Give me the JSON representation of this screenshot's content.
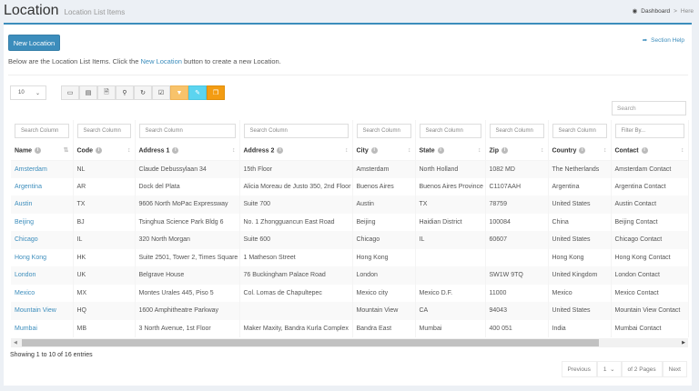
{
  "header": {
    "title": "Location",
    "subtitle": "Location List Items"
  },
  "breadcrumb": {
    "home": "Dashboard",
    "separator": ">",
    "current": "Here"
  },
  "panel": {
    "new_button": "New Location",
    "section_help": "Section Help",
    "intro_before": "Below are the Location List Items. Click the ",
    "intro_link": "New Location",
    "intro_after": " button to create a new Location.",
    "page_length": "10",
    "search_placeholder": "Search"
  },
  "toolbar": [
    "monitor-icon",
    "columns-icon",
    "file-icon",
    "zoom-icon",
    "refresh-icon",
    "check-square-icon",
    "filter-icon",
    "edit-icon",
    "copy-icon"
  ],
  "table": {
    "filters": [
      "Search Column",
      "Search Column",
      "Search Column",
      "Search Column",
      "Search Column",
      "Search Column",
      "Search Column",
      "Search Column",
      "Filter By..."
    ],
    "columns": [
      "Name",
      "Code",
      "Address 1",
      "Address 2",
      "City",
      "State",
      "Zip",
      "Country",
      "Contact"
    ],
    "rows": [
      [
        "Amsterdam",
        "NL",
        "Claude Debussylaan 34",
        "15th Floor",
        "Amsterdam",
        "North Holland",
        "1082 MD",
        "The Netherlands",
        "Amsterdam Contact"
      ],
      [
        "Argentina",
        "AR",
        "Dock del Plata",
        "Alicia Moreau de Justo 350, 2nd Floor",
        "Buenos Aires",
        "Buenos Aires Province",
        "C1107AAH",
        "Argentina",
        "Argentina Contact"
      ],
      [
        "Austin",
        "TX",
        "9606 North MoPac Expressway",
        "Suite 700",
        "Austin",
        "TX",
        "78759",
        "United States",
        "Austin Contact"
      ],
      [
        "Beijing",
        "BJ",
        "Tsinghua Science Park Bldg 6",
        "No. 1 Zhongguancun East Road",
        "Beijing",
        "Haidian District",
        "100084",
        "China",
        "Beijing Contact"
      ],
      [
        "Chicago",
        "IL",
        "320 North Morgan",
        "Suite 600",
        "Chicago",
        "IL",
        "60607",
        "United States",
        "Chicago Contact"
      ],
      [
        "Hong Kong",
        "HK",
        "Suite 2501, Tower 2, Times Square",
        "1 Matheson Street",
        "Hong Kong",
        "",
        "",
        "Hong Kong",
        "Hong Kong Contact"
      ],
      [
        "London",
        "UK",
        "Belgrave House",
        "76 Buckingham Palace Road",
        "London",
        "",
        "SW1W 9TQ",
        "United Kingdom",
        "London Contact"
      ],
      [
        "Mexico",
        "MX",
        "Montes Urales 445, Piso 5",
        "Col. Lomas de Chapultepec",
        "Mexico city",
        "Mexico D.F.",
        "11000",
        "Mexico",
        "Mexico Contact"
      ],
      [
        "Mountain View",
        "HQ",
        "1600 Amphitheatre Parkway",
        "",
        "Mountain View",
        "CA",
        "94043",
        "United States",
        "Mountain View Contact"
      ],
      [
        "Mumbai",
        "MB",
        "3 North Avenue, 1st Floor",
        "Maker Maxity, Bandra Kurla Complex",
        "Bandra East",
        "Mumbai",
        "400 051",
        "India",
        "Mumbai Contact"
      ]
    ]
  },
  "footer": {
    "info": "Showing 1 to 10 of 16 entries",
    "previous": "Previous",
    "page": "1",
    "of_pages": "of 2 Pages",
    "next": "Next"
  },
  "colors": {
    "accent": "#3c8dbc",
    "warning": "#f39c12",
    "info": "#5bd4ef"
  }
}
